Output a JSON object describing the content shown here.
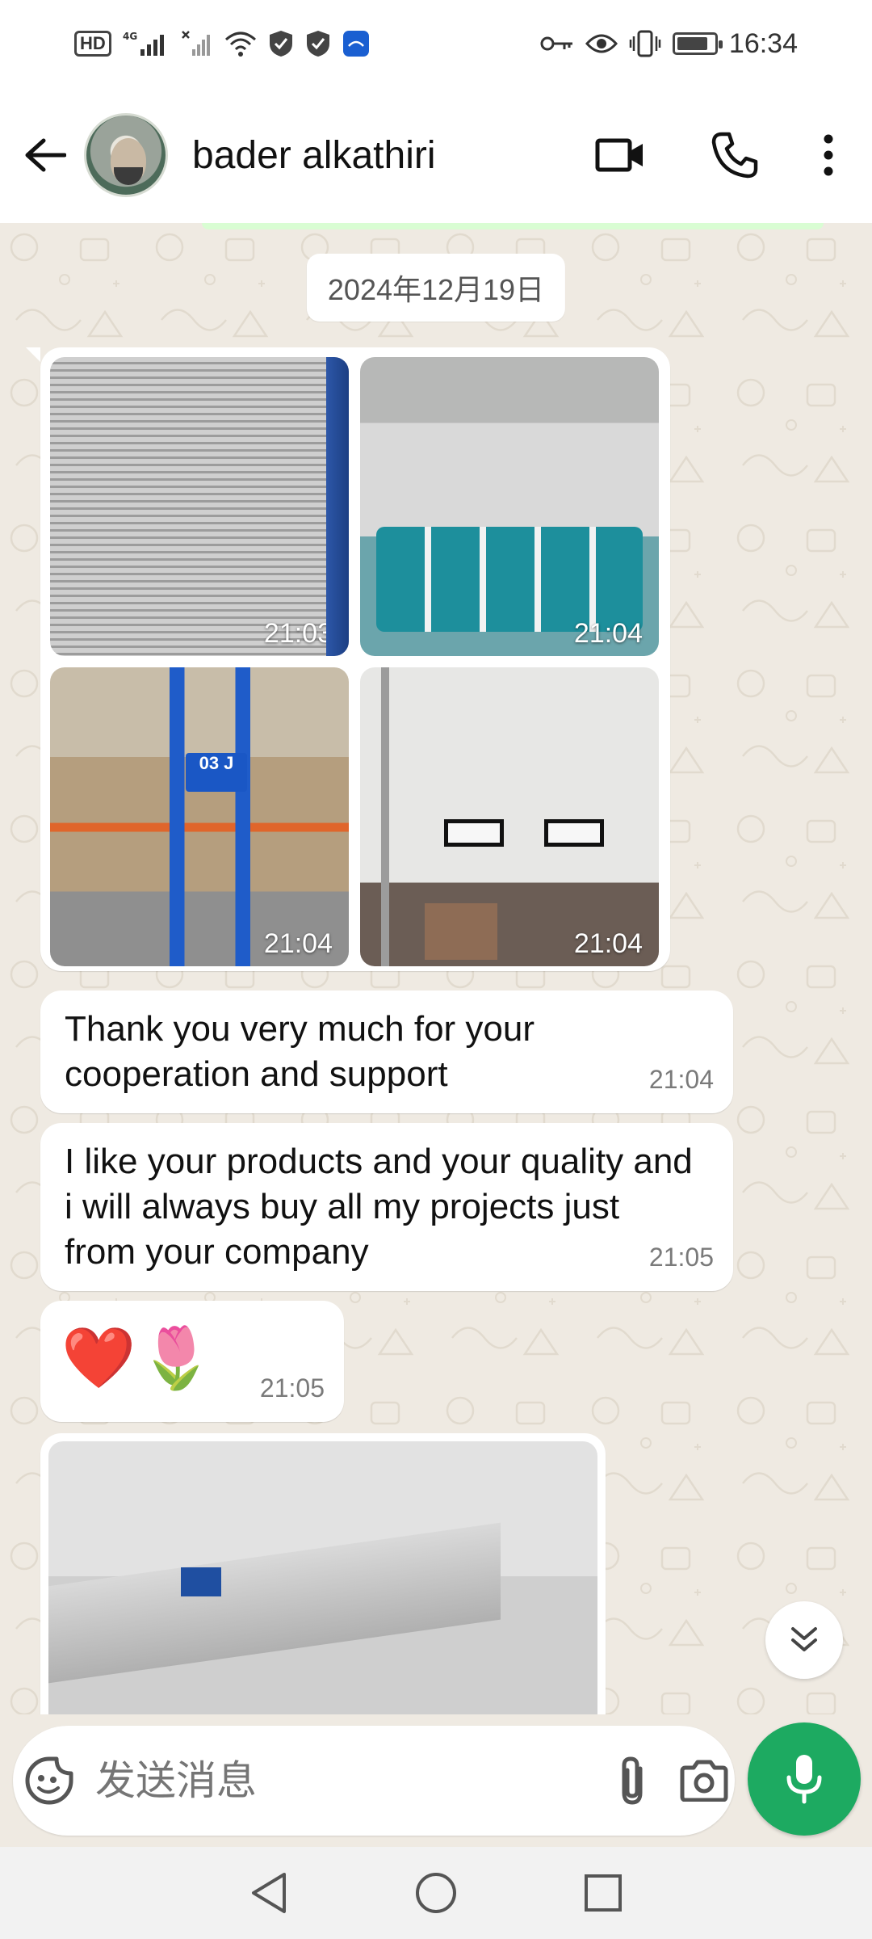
{
  "status_bar": {
    "hd_label": "HD",
    "network_label": "4G",
    "time": "16:34",
    "icons": [
      "hd-icon",
      "signal-icon",
      "no-signal-icon",
      "wifi-icon",
      "shield-icon",
      "shield-icon",
      "app-badge-icon",
      "key-icon",
      "eye-icon",
      "vibrate-icon",
      "battery-icon"
    ],
    "battery_level": 0.85
  },
  "header": {
    "contact_name": "bader alkathiri",
    "icons": [
      "back-arrow-icon",
      "video-call-icon",
      "phone-icon",
      "more-vert-icon"
    ]
  },
  "chat": {
    "date_divider": "2024年12月19日",
    "album": {
      "photos": [
        {
          "time": "21:03"
        },
        {
          "time": "21:04"
        },
        {
          "time": "21:04",
          "sign_text": "03 J"
        },
        {
          "time": "21:04"
        }
      ]
    },
    "messages": [
      {
        "text": "Thank you very much for your cooperation and support",
        "time": "21:04"
      },
      {
        "text": "I like your products and your quality and i will always buy all my projects just from your company",
        "time": "21:05"
      },
      {
        "text": "❤️🌷",
        "time": "21:05"
      }
    ]
  },
  "composer": {
    "placeholder": "发送消息",
    "icons": [
      "sticker-icon",
      "attach-icon",
      "camera-icon",
      "mic-icon"
    ]
  },
  "nav": {
    "icons": [
      "back-triangle-icon",
      "home-circle-icon",
      "recents-square-icon"
    ]
  },
  "colors": {
    "chat_background": "#efeae2",
    "accent_green": "#1daa61",
    "bubble": "#ffffff"
  }
}
